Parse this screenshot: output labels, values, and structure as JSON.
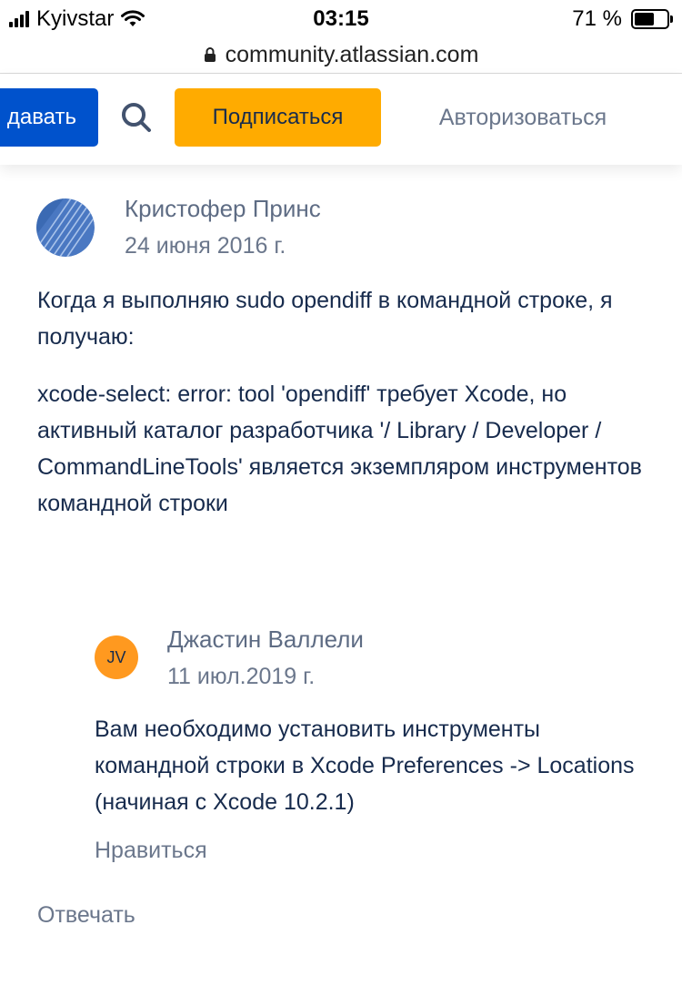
{
  "status_bar": {
    "carrier": "Kyivstar",
    "time": "03:15",
    "battery": "71 %",
    "battery_level": 0.71
  },
  "browser": {
    "url": "community.atlassian.com"
  },
  "header": {
    "ask_button": "давать",
    "subscribe_button": "Подписаться",
    "login_link": "Авторизоваться",
    "colors": {
      "ask": "#0052cc",
      "subscribe": "#ffab00"
    }
  },
  "post": {
    "author": "Кристофер Принс",
    "date": "24 июня 2016 г.",
    "paragraph1": "Когда я выполняю sudo opendiff в командной строке, я получаю:",
    "paragraph2": "xcode-select: error: tool 'opendiff' требует Xcode, но активный каталог разработчика '/ Library / Developer / CommandLineTools' является экземпляром инструментов командной строки",
    "reply_link": "Отвечать"
  },
  "reply": {
    "avatar_initials": "JV",
    "author": "Джастин Валлели",
    "date": "11 июл.2019 г.",
    "text": "Вам необходимо установить инструменты командной строки в Xcode Preferences -> Locations (начиная с Xcode 10.2.1)",
    "like_link": "Нравиться"
  }
}
